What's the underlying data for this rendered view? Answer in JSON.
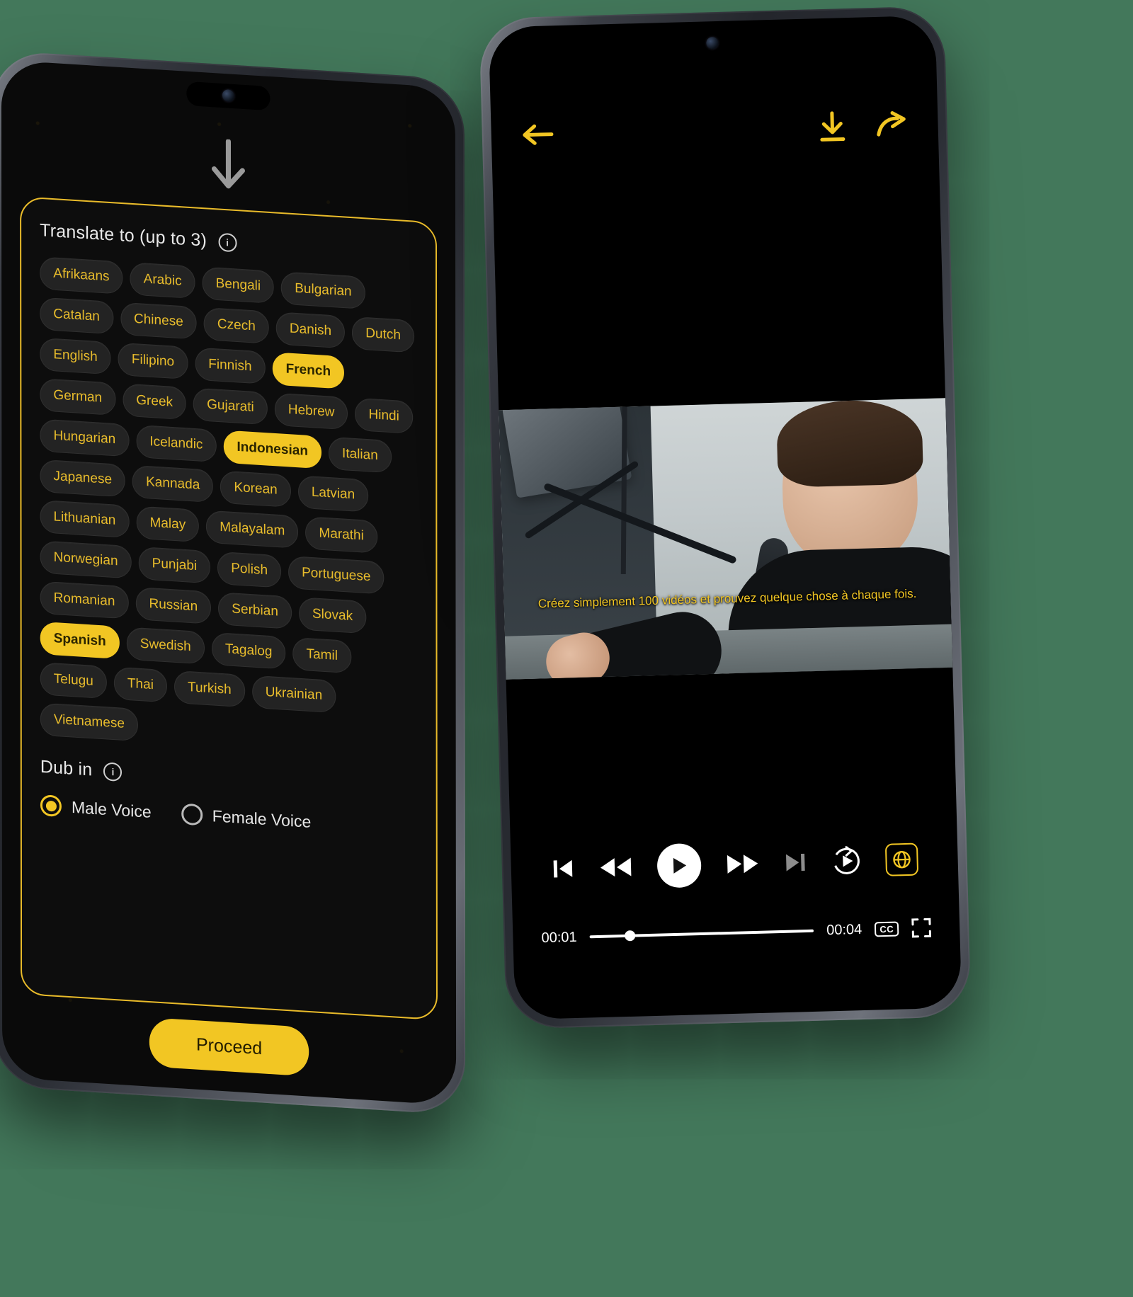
{
  "left_phone": {
    "screen_name": "translate-options",
    "section_translate": {
      "title": "Translate to (up to 3)",
      "info_icon": "info-icon",
      "languages": [
        {
          "label": "Afrikaans",
          "selected": false
        },
        {
          "label": "Arabic",
          "selected": false
        },
        {
          "label": "Bengali",
          "selected": false
        },
        {
          "label": "Bulgarian",
          "selected": false
        },
        {
          "label": "Catalan",
          "selected": false
        },
        {
          "label": "Chinese",
          "selected": false
        },
        {
          "label": "Czech",
          "selected": false
        },
        {
          "label": "Danish",
          "selected": false
        },
        {
          "label": "Dutch",
          "selected": false
        },
        {
          "label": "English",
          "selected": false
        },
        {
          "label": "Filipino",
          "selected": false
        },
        {
          "label": "Finnish",
          "selected": false
        },
        {
          "label": "French",
          "selected": true
        },
        {
          "label": "German",
          "selected": false
        },
        {
          "label": "Greek",
          "selected": false
        },
        {
          "label": "Gujarati",
          "selected": false
        },
        {
          "label": "Hebrew",
          "selected": false
        },
        {
          "label": "Hindi",
          "selected": false
        },
        {
          "label": "Hungarian",
          "selected": false
        },
        {
          "label": "Icelandic",
          "selected": false
        },
        {
          "label": "Indonesian",
          "selected": true
        },
        {
          "label": "Italian",
          "selected": false
        },
        {
          "label": "Japanese",
          "selected": false
        },
        {
          "label": "Kannada",
          "selected": false
        },
        {
          "label": "Korean",
          "selected": false
        },
        {
          "label": "Latvian",
          "selected": false
        },
        {
          "label": "Lithuanian",
          "selected": false
        },
        {
          "label": "Malay",
          "selected": false
        },
        {
          "label": "Malayalam",
          "selected": false
        },
        {
          "label": "Marathi",
          "selected": false
        },
        {
          "label": "Norwegian",
          "selected": false
        },
        {
          "label": "Punjabi",
          "selected": false
        },
        {
          "label": "Polish",
          "selected": false
        },
        {
          "label": "Portuguese",
          "selected": false
        },
        {
          "label": "Romanian",
          "selected": false
        },
        {
          "label": "Russian",
          "selected": false
        },
        {
          "label": "Serbian",
          "selected": false
        },
        {
          "label": "Slovak",
          "selected": false
        },
        {
          "label": "Spanish",
          "selected": true
        },
        {
          "label": "Swedish",
          "selected": false
        },
        {
          "label": "Tagalog",
          "selected": false
        },
        {
          "label": "Tamil",
          "selected": false
        },
        {
          "label": "Telugu",
          "selected": false
        },
        {
          "label": "Thai",
          "selected": false
        },
        {
          "label": "Turkish",
          "selected": false
        },
        {
          "label": "Ukrainian",
          "selected": false
        },
        {
          "label": "Vietnamese",
          "selected": false
        }
      ]
    },
    "section_dub": {
      "title": "Dub in",
      "info_icon": "info-icon",
      "options": [
        {
          "label": "Male Voice",
          "selected": true
        },
        {
          "label": "Female Voice",
          "selected": false
        }
      ]
    },
    "proceed_label": "Proceed",
    "scroll_hint_icon": "down-arrow-icon"
  },
  "right_phone": {
    "screen_name": "video-player",
    "top_bar": {
      "back_icon": "back-arrow-icon",
      "download_icon": "download-icon",
      "share_icon": "share-icon"
    },
    "video": {
      "caption": "Créez simplement 100 vidéos et prouvez quelque chose à chaque fois."
    },
    "controls": {
      "skip_start_icon": "skip-to-start-icon",
      "rewind_icon": "rewind-icon",
      "play_icon": "play-icon",
      "forward_icon": "fast-forward-icon",
      "skip_end_icon": "skip-to-end-icon",
      "replay_icon": "replay-icon",
      "language_icon": "globe-language-icon"
    },
    "timeline": {
      "current_time": "00:01",
      "total_time": "00:04",
      "progress_percent": 18,
      "cc_label": "CC",
      "fullscreen_icon": "fullscreen-icon"
    }
  },
  "colors": {
    "accent": "#f2c623",
    "chip_bg": "#232323",
    "chip_text": "#e8bc2c",
    "screen_bg": "#0a0a0a",
    "background": "#43785b"
  }
}
